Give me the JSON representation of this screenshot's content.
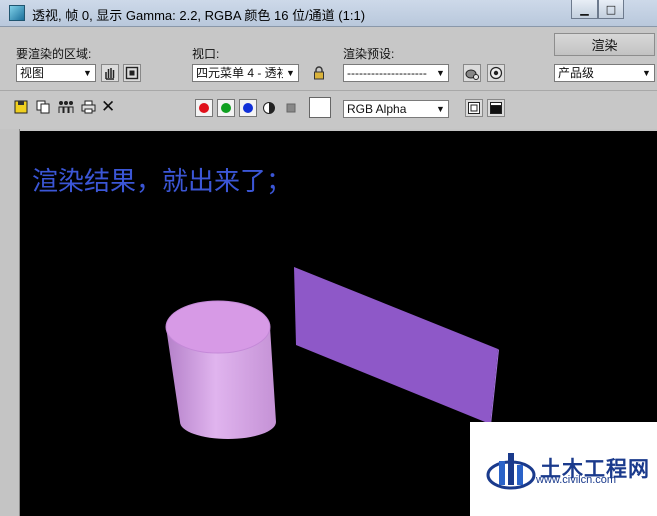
{
  "window": {
    "title": "透视, 帧 0, 显示 Gamma: 2.2, RGBA 颜色 16 位/通道 (1:1)",
    "minimize_glyph": "▁",
    "maximize_glyph": "□"
  },
  "toolbar": {
    "area_label": "要渲染的区域:",
    "area_value": "视图",
    "viewport_label": "视口:",
    "viewport_value": "四元菜单 4 - 透衫",
    "preset_label": "渲染预设:",
    "preset_value": "--------------------",
    "render_label": "渲染",
    "quality_value": "产品级",
    "channel_value": "RGB Alpha",
    "close_glyph": "✕"
  },
  "colors": {
    "red": "#e0101a",
    "green": "#0fa020",
    "blue": "#1030d8",
    "caption": "#3b56d6",
    "cylinder": "#d79ae6",
    "panel": "#8e58c8"
  },
  "viewport": {
    "caption": "渲染结果，就出来了；"
  },
  "watermark": {
    "name": "土木工程网",
    "url": "www.civilcn.com"
  }
}
